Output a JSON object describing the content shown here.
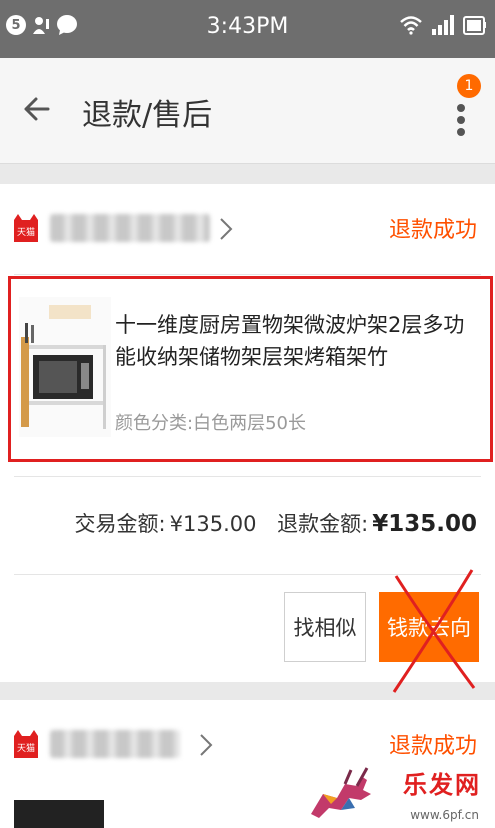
{
  "status_bar": {
    "notif_count": "5",
    "time": "3:43PM"
  },
  "app_bar": {
    "title": "退款/售后",
    "badge_count": "1"
  },
  "orders": [
    {
      "store_badge": "天猫",
      "status": "退款成功",
      "product_name": "十一维度厨房置物架微波炉架2层多功能收纳架储物架层架烤箱架竹",
      "attributes": "颜色分类:白色两层50长",
      "trade_label": "交易金额:",
      "trade_amount": "¥135.00",
      "refund_label": "退款金额:",
      "refund_amount": "¥135.00",
      "btn_similar": "找相似",
      "btn_refund_flow": "钱款去向"
    },
    {
      "store_badge": "天猫",
      "status": "退款成功"
    }
  ],
  "watermark": {
    "brand": "乐发网",
    "site": "www.6pf.cn"
  },
  "colors": {
    "accent": "#ff6b00",
    "status_text": "#ff5000",
    "highlight_box": "#e02020",
    "statusbar_bg": "#6e6e6e"
  }
}
